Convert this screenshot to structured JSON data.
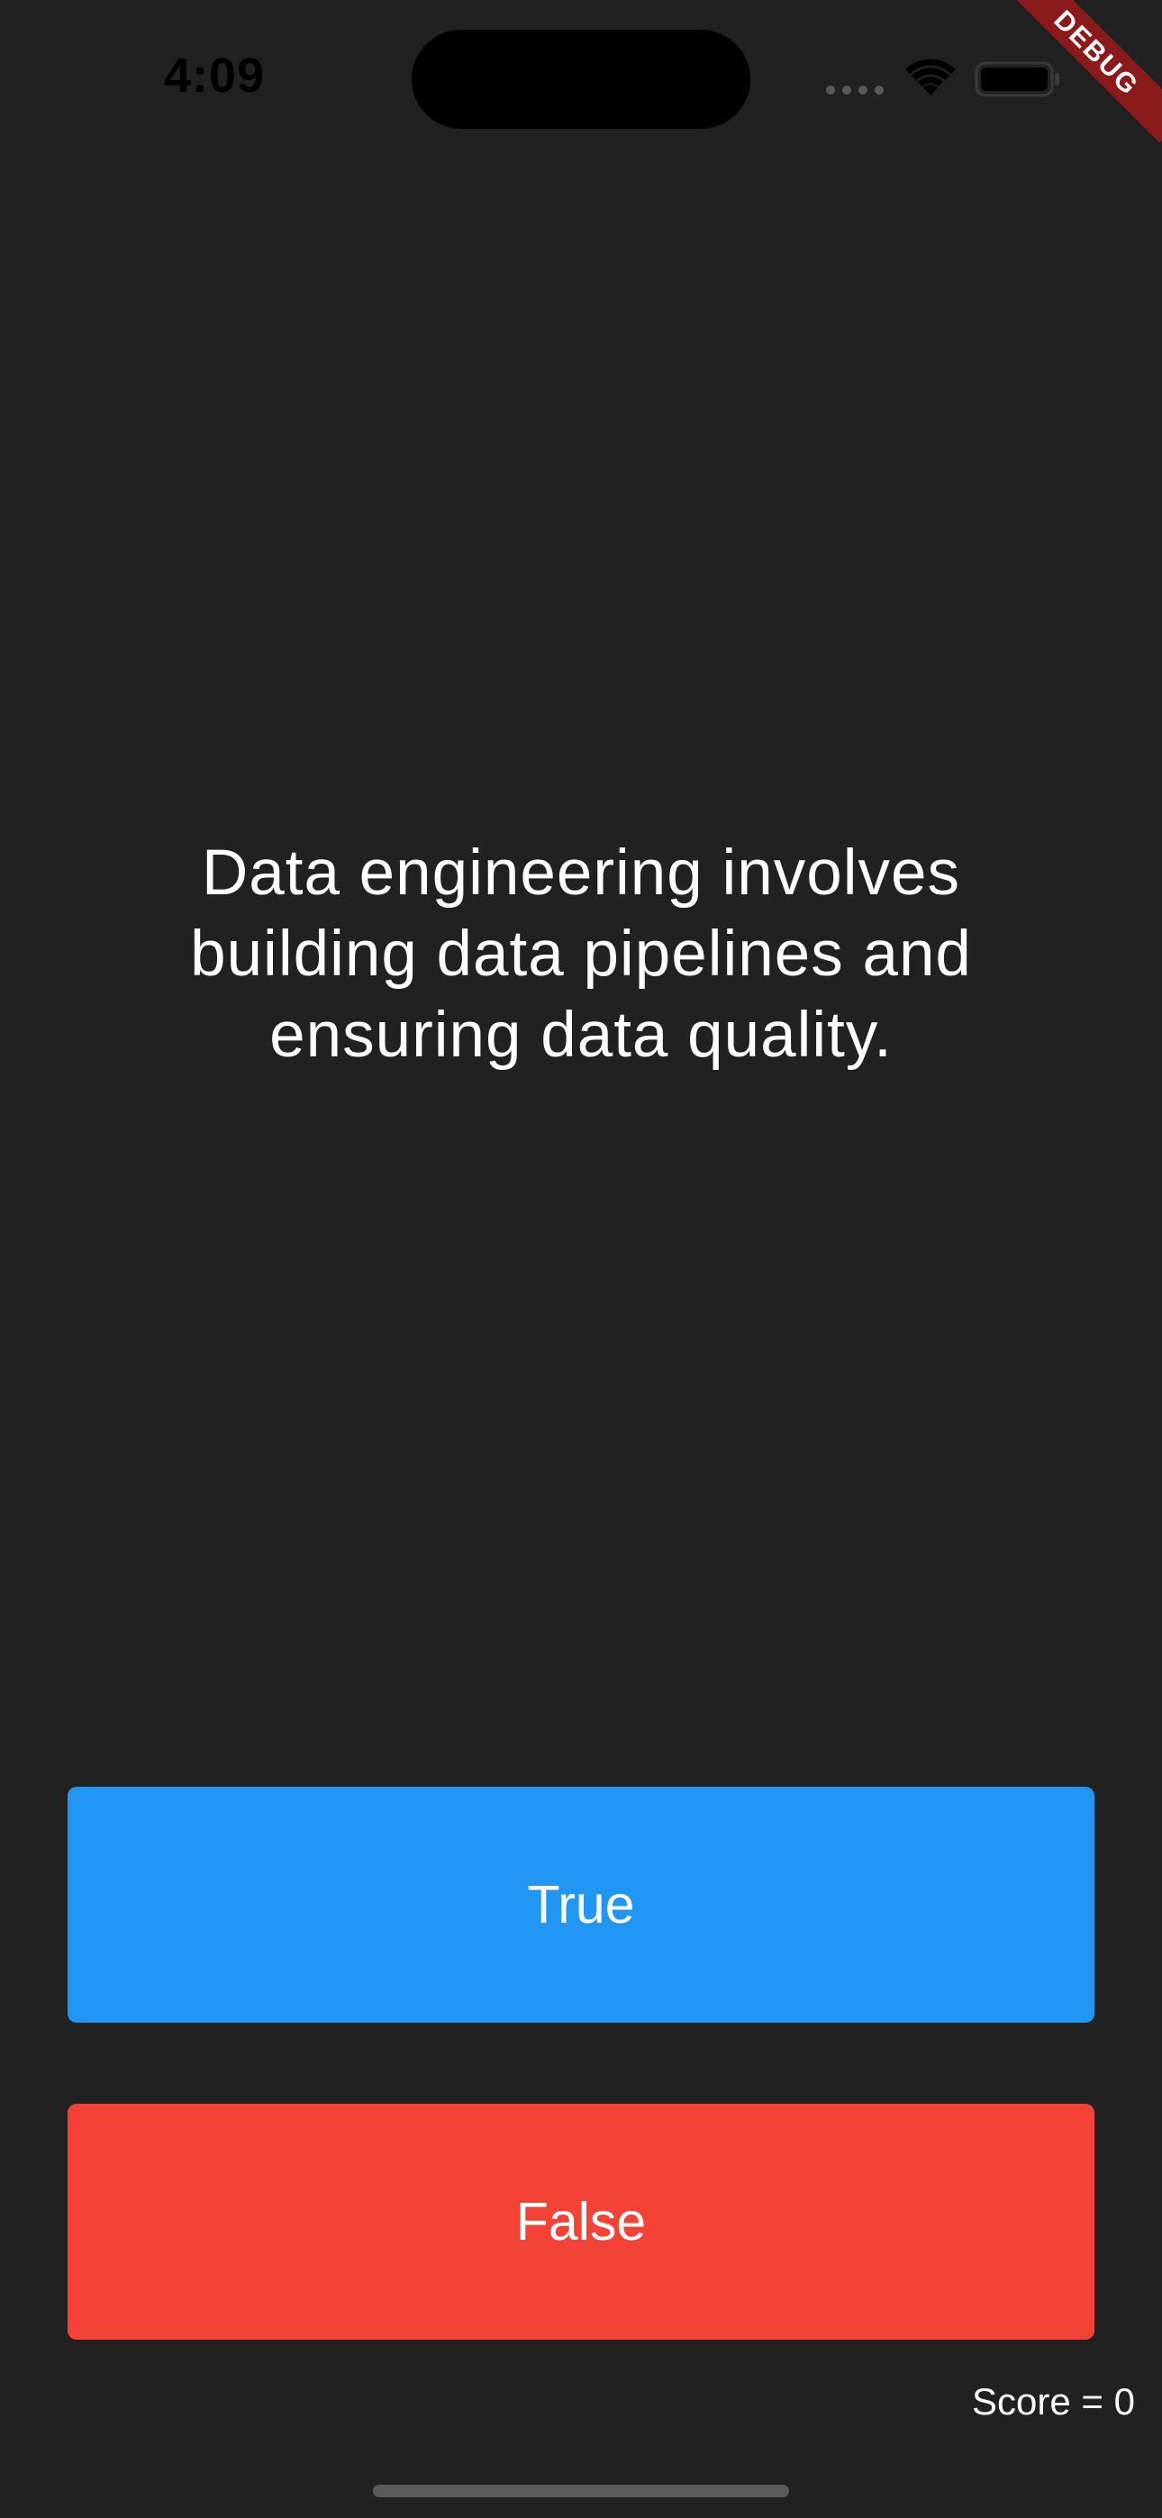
{
  "status_bar": {
    "time": "4:09"
  },
  "debug_banner": {
    "label": "DEBUG",
    "color": "#8b1a1a"
  },
  "question": {
    "line1": "Data engineering involves",
    "line2": "building data pipelines and",
    "line3": "ensuring data quality."
  },
  "buttons": {
    "true_label": "True",
    "false_label": "False",
    "true_color": "#2196f3",
    "false_color": "#f44336"
  },
  "score": {
    "text": "Score = 0"
  },
  "icons": {
    "signal": "cellular-signal-icon",
    "wifi": "wifi-icon",
    "battery": "battery-icon"
  }
}
